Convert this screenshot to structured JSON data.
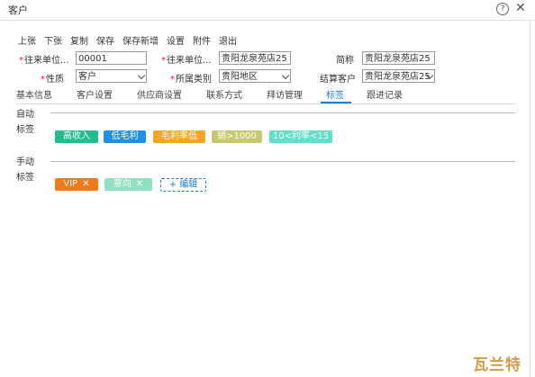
{
  "window": {
    "title": "客户"
  },
  "toolbar": [
    "上张",
    "下张",
    "复制",
    "保存",
    "保存新增",
    "设置",
    "附件",
    "退出"
  ],
  "form": {
    "code_label": "往来单位...",
    "code_value": "00001",
    "name_label": "往来单位...",
    "name_value": "贵阳龙泉苑店25",
    "short_label": "简称",
    "short_value": "贵阳龙泉苑店25",
    "nature_label": "性质",
    "nature_value": "客户",
    "region_label": "所属类别",
    "region_value": "贵阳地区",
    "settle_label": "结算客户",
    "settle_value": "贵阳龙泉苑店25"
  },
  "tabs": [
    "基本信息",
    "客户设置",
    "供应商设置",
    "联系方式",
    "拜访管理",
    "标签",
    "跟进记录"
  ],
  "active_tab": "标签",
  "auto_tags": {
    "title": "自动标签",
    "items": [
      {
        "label": "高收入",
        "color": "#1fbf8f"
      },
      {
        "label": "低毛利",
        "color": "#1e90e6"
      },
      {
        "label": "毛利率低",
        "color": "#f5a623"
      },
      {
        "label": "销>1000",
        "color": "#c8c96a"
      },
      {
        "label": "10<利率<15",
        "color": "#5fe0c8"
      }
    ]
  },
  "manual_tags": {
    "title": "手动标签",
    "items": [
      {
        "label": "VIP",
        "color": "#f07a1a"
      },
      {
        "label": "意向",
        "color": "#8fe0c0"
      }
    ],
    "edit_label": "+ 编辑"
  },
  "watermark": "瓦兰特"
}
